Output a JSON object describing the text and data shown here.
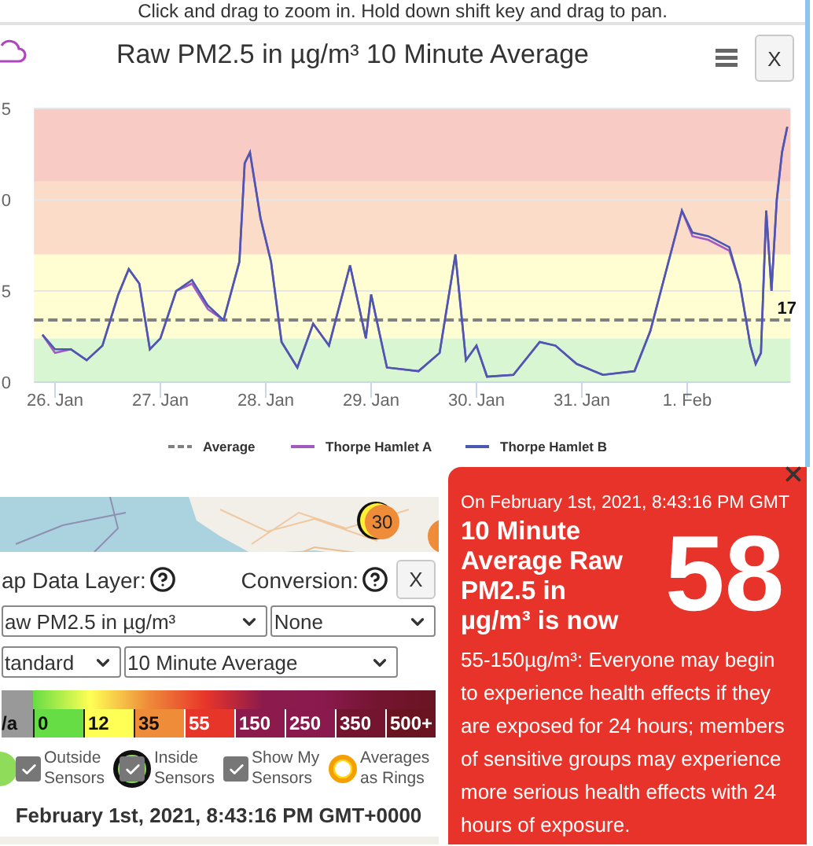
{
  "hint": "Click and drag to zoom in. Hold down shift key and drag to pan.",
  "chart_panel": {
    "title": "Raw PM2.5 in µg/m³ 10 Minute Average",
    "close_button": "X",
    "y_axis_labels": [
      "5",
      "0",
      "5",
      "0"
    ],
    "x_axis_labels": [
      "26. Jan",
      "27. Jan",
      "28. Jan",
      "29. Jan",
      "30. Jan",
      "31. Jan",
      "1. Feb"
    ],
    "average_label": "17",
    "legend": [
      {
        "kind": "dashed",
        "name": "Average",
        "color": "#808080"
      },
      {
        "kind": "solid",
        "name": "Thorpe Hamlet A",
        "color": "#a259c4"
      },
      {
        "kind": "solid",
        "name": "Thorpe Hamlet B",
        "color": "#4b57b0"
      }
    ]
  },
  "map": {
    "markers": [
      {
        "kind": "labeled",
        "label": "30"
      },
      {
        "kind": "plain"
      }
    ]
  },
  "layer_panel": {
    "layer_label": "ap Data Layer:",
    "conversion_label": "Conversion:",
    "close_button": "X",
    "selects": [
      [
        {
          "value": "aw PM2.5 in µg/m³"
        },
        {
          "value": "None"
        }
      ],
      [
        {
          "value": "tandard"
        },
        {
          "value": "10 Minute Average"
        }
      ]
    ],
    "scale": [
      {
        "label": "/a",
        "color": "#999999"
      },
      {
        "label": "0",
        "color": "#66dd44"
      },
      {
        "label": "12",
        "color": "#ffff55"
      },
      {
        "label": "35",
        "color": "#ee8c3a"
      },
      {
        "label": "55",
        "color": "#e8352a"
      },
      {
        "label": "150",
        "color": "#8c1a4c"
      },
      {
        "label": "250",
        "color": "#8a1a4e"
      },
      {
        "label": "350",
        "color": "#741530"
      },
      {
        "label": "500+",
        "color": "#6a1422"
      }
    ],
    "toggles": [
      {
        "kind": "outside",
        "label": "Outside Sensors",
        "checked": true
      },
      {
        "kind": "inside",
        "label": "Inside Sensors",
        "checked": true
      },
      {
        "kind": "plain",
        "label": "Show My Sensors",
        "checked": true
      },
      {
        "kind": "ring",
        "label": "Averages as Rings"
      }
    ],
    "timestamp": "February 1st, 2021, 8:43:16 PM GMT+0000"
  },
  "popup": {
    "timestamp": "On February 1st, 2021, 8:43:16 PM GMT",
    "heading": "10 Minute Average Raw PM2.5 in µg/m³ is now",
    "value": "58",
    "description": "55-150µg/m³: Everyone may begin to experience health effects if they are exposed for 24 hours; members of sensitive groups may experience more serious health effects with 24 hours of exposure."
  }
}
